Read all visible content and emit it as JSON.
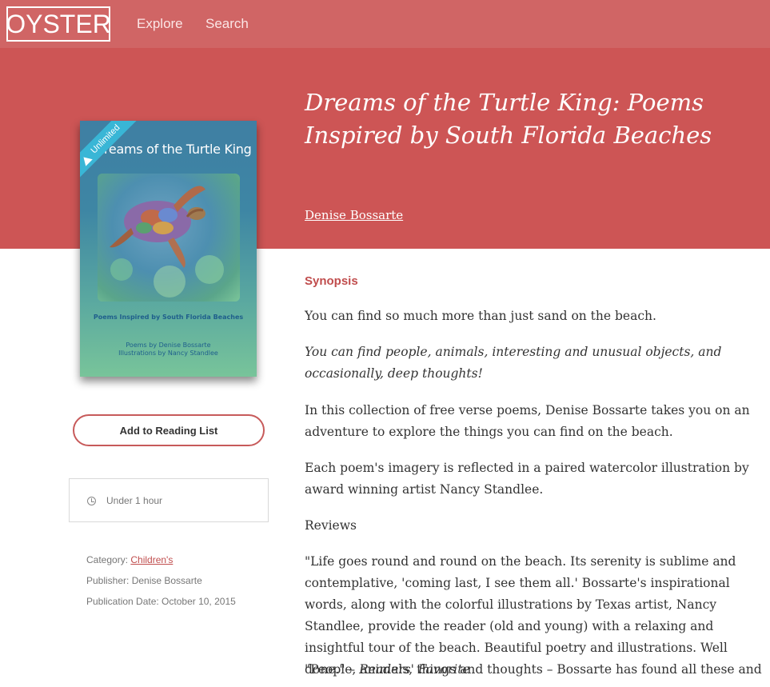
{
  "nav": {
    "logo": "OYSTER",
    "explore": "Explore",
    "search": "Search"
  },
  "book": {
    "title": "Dreams of the Turtle King: Poems Inspired by South Florida Beaches",
    "author": "Denise Bossarte",
    "cover": {
      "ribbon": "Unlimited",
      "title": "reams of the Turtle King",
      "subtitle": "Poems Inspired by South Florida Beaches",
      "credit_line_1": "Poems by Denise Bossarte",
      "credit_line_2": "Illustrations by Nancy Standlee"
    }
  },
  "actions": {
    "add_to_reading_list": "Add to Reading List"
  },
  "details": {
    "duration": "Under 1 hour",
    "category_label": "Category: ",
    "category": "Children's",
    "publisher": "Publisher: Denise Bossarte",
    "publication_date": "Publication Date: October 10, 2015"
  },
  "synopsis": {
    "heading": "Synopsis",
    "p1": "You can find so much more than just sand on the beach.",
    "p2": "You can find people, animals, interesting and unusual objects, and occasionally, deep thoughts!",
    "p3": "In this collection of free verse poems, Denise Bossarte takes you on an adventure to explore the things you can find on the beach.",
    "p4": "Each poem's imagery is reflected in a paired watercolor illustration by award winning artist Nancy Standlee.",
    "p5": "Reviews",
    "p6": "\"Life goes round and round on the beach. Its serenity is sublime and contemplative, 'coming last, I see them all.' Bossarte's inspirational words, along with the colorful illustrations by Texas artist, Nancy Standlee, provide the reader (old and young) with a relaxing and insightful tour of the beach. Beautiful poetry and illustrations. Well done.\" – ",
    "p6_source": "Readers' Favorite",
    "p7": "\"People, animals, things and thoughts – Bossarte has found all these and"
  },
  "colors": {
    "nav_bg": "#d06565",
    "hero_bg": "#cd5555",
    "accent": "#c04d4d"
  }
}
